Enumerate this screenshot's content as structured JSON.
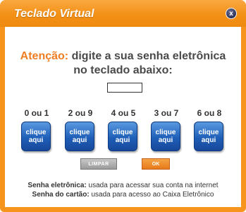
{
  "window": {
    "title": "Teclado Virtual",
    "close_label": "x"
  },
  "attention": {
    "prefix": "Atenção:",
    "line1": " digite a sua senha eletrônica",
    "line2": "no teclado abaixo:"
  },
  "keys": [
    {
      "label": "0 ou 1",
      "btn1": "clique",
      "btn2": "aqui"
    },
    {
      "label": "2 ou 9",
      "btn1": "clique",
      "btn2": "aqui"
    },
    {
      "label": "4 ou 5",
      "btn1": "clique",
      "btn2": "aqui"
    },
    {
      "label": "3 ou 7",
      "btn1": "clique",
      "btn2": "aqui"
    },
    {
      "label": "6 ou 8",
      "btn1": "clique",
      "btn2": "aqui"
    }
  ],
  "actions": {
    "clear_label": "LIMPAR",
    "ok_label": "OK"
  },
  "notes": {
    "line1_bold": "Senha eletrônica:",
    "line1_text": " usada para acessar sua conta na internet",
    "line2_bold": "Senha do cartão:",
    "line2_text": " usada para acesso ao Caixa Eletrônico"
  },
  "colors": {
    "window_orange": "#f7941d",
    "highlight_orange": "#ef7d22",
    "key_blue": "#1f5fb8"
  }
}
